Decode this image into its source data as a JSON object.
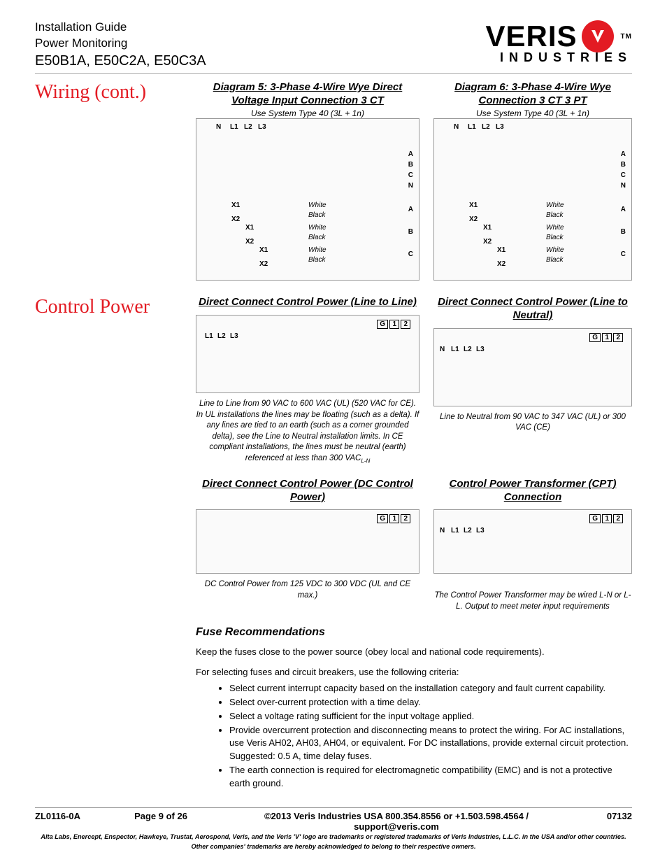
{
  "header": {
    "line1": "Installation Guide",
    "line2": "Power Monitoring",
    "models": "E50B1A, E50C2A, E50C3A",
    "logo_top": "VERIS",
    "logo_bottom": "INDUSTRIES",
    "logo_tm": "TM"
  },
  "section1": {
    "title": "Wiring (cont.)",
    "diag5": {
      "title": "Diagram 5:  3-Phase 4-Wire Wye Direct Voltage Input Connection 3 CT",
      "sub": "Use System Type  40 (3L + 1n)",
      "lines": [
        "N",
        "L1",
        "L2",
        "L3"
      ],
      "volt_rows": [
        "A",
        "B",
        "C",
        "N"
      ],
      "ct_rows": [
        {
          "x1": "X1",
          "x2": "X2",
          "w": "White",
          "b": "Black",
          "lab": "A"
        },
        {
          "x1": "X1",
          "x2": "X2",
          "w": "White",
          "b": "Black",
          "lab": "B"
        },
        {
          "x1": "X1",
          "x2": "X2",
          "w": "White",
          "b": "Black",
          "lab": "C"
        }
      ]
    },
    "diag6": {
      "title": "Diagram 6:   3-Phase 4-Wire Wye Connection 3 CT 3 PT",
      "sub": "Use System Type 40 (3L + 1n)",
      "lines": [
        "N",
        "L1",
        "L2",
        "L3"
      ],
      "volt_rows": [
        "A",
        "B",
        "C",
        "N"
      ],
      "ct_rows": [
        {
          "x1": "X1",
          "x2": "X2",
          "w": "White",
          "b": "Black",
          "lab": "A"
        },
        {
          "x1": "X1",
          "x2": "X2",
          "w": "White",
          "b": "Black",
          "lab": "B"
        },
        {
          "x1": "X1",
          "x2": "X2",
          "w": "White",
          "b": "Black",
          "lab": "C"
        }
      ]
    }
  },
  "section2": {
    "title": "Control Power",
    "d1": {
      "title": "Direct Connect Control Power (Line to Line)",
      "lines": [
        "L1",
        "L2",
        "L3"
      ],
      "term": [
        "G",
        "1",
        "2"
      ],
      "caption_pre": "Line to Line  from 90 VAC to 600 VAC (UL) (520 VAC for CE). In UL installations the lines may be floating (such as a delta). If any lines are tied to an earth (such as a corner grounded delta), see the Line to Neutral installation limits. In CE compliant installations, the lines must be neutral (earth) referenced at less than 300 VAC",
      "caption_sub": "L-N"
    },
    "d2": {
      "title": "Direct Connect Control Power (Line to Neutral)",
      "lines": [
        "N",
        "L1",
        "L2",
        "L3"
      ],
      "term": [
        "G",
        "1",
        "2"
      ],
      "caption": "Line to Neutral from 90 VAC to 347 VAC (UL) or 300 VAC (CE)"
    },
    "d3": {
      "title": "Direct Connect Control Power (DC Control Power)",
      "term": [
        "G",
        "1",
        "2"
      ],
      "caption": "DC Control Power from 125 VDC to 300 VDC (UL and CE max.)"
    },
    "d4": {
      "title": "Control Power Transformer (CPT) Connection",
      "lines": [
        "N",
        "L1",
        "L2",
        "L3"
      ],
      "term": [
        "G",
        "1",
        "2"
      ],
      "caption": "The Control Power Transformer may be wired L-N or L-L. Output to meet meter input requirements"
    }
  },
  "fuse": {
    "title": "Fuse Recommendations",
    "p1": "Keep the fuses close to the power source (obey local and national code requirements).",
    "p2": "For selecting fuses and circuit breakers, use the following criteria:",
    "bullets": [
      "Select current interrupt capacity based on the installation category and fault current capability.",
      "Select over-current protection with a time delay.",
      "Select a voltage rating sufficient for the input voltage applied.",
      "Provide overcurrent protection and disconnecting means to protect the wiring. For AC installations, use Veris AH02, AH03, AH04, or equivalent. For DC installations, provide external circuit protection. Suggested: 0.5 A, time delay fuses.",
      "The earth connection is required for electromagnetic compatibility (EMC) and is not a protective earth ground."
    ]
  },
  "footer": {
    "doc": "ZL0116-0A",
    "page": "Page 9 of 26",
    "copy": "©2013 Veris Industries  USA 800.354.8556 or +1.503.598.4564  / support@veris.com",
    "date": "07132",
    "legal1": "Alta Labs, Enercept, Enspector, Hawkeye, Trustat, Aerospond, Veris, and the Veris 'V' logo are trademarks or registered trademarks of  Veris Industries, L.L.C. in the USA and/or other countries.",
    "legal2": "Other companies' trademarks are hereby acknowledged to belong to their respective owners."
  }
}
